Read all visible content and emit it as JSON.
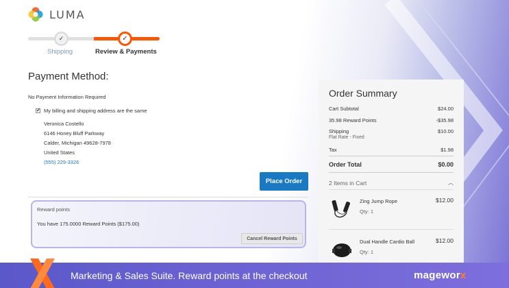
{
  "logo": {
    "text": "LUMA"
  },
  "progress": {
    "steps": [
      {
        "label": "Shipping",
        "state": "complete"
      },
      {
        "label": "Review & Payments",
        "state": "active"
      }
    ],
    "check_glyph": "✓"
  },
  "payment": {
    "title": "Payment Method:",
    "no_info": "No Payment Information Required",
    "same_address_label": "My billing and shipping address are the same",
    "same_address_checked": true,
    "address": {
      "name": "Veronica Costello",
      "street": "6146 Honey Bluff Parkway",
      "city_line": "Calder, Michigan 49628-7978",
      "country": "United States",
      "phone": "(555) 229-3326"
    },
    "place_order_label": "Place Order"
  },
  "reward": {
    "title": "Reward points",
    "text": "You have 175.0000 Reward Points ($175.00)",
    "cancel_label": "Cancel Reward Points"
  },
  "summary": {
    "title": "Order Summary",
    "rows": [
      {
        "label": "Cart Subtotal",
        "value": "$24.00"
      },
      {
        "label": "35.98 Reward Points",
        "value": "-$35.98"
      },
      {
        "label": "Shipping",
        "value": "$10.00",
        "sub": "Flat Rate - Fixed"
      },
      {
        "label": "Tax",
        "value": "$1.98"
      }
    ],
    "total": {
      "label": "Order Total",
      "value": "$0.00"
    },
    "items_in_cart": "2 Items in Cart",
    "items": [
      {
        "name": "Zing Jump Rope",
        "qty": "Qty: 1",
        "price": "$12.00",
        "icon": "jump-rope-icon"
      },
      {
        "name": "Dual Handle Cardio Ball",
        "qty": "Qty: 1",
        "price": "$12.00",
        "icon": "cardio-ball-icon"
      }
    ]
  },
  "banner": {
    "text": "Marketing & Sales Suite. Reward points at the checkout",
    "brand_a": "magewor",
    "brand_b": "x"
  },
  "colors": {
    "accent": "#ff5501",
    "primary_button": "#1979c3",
    "banner": "#6e63d4",
    "reward_border": "#b7b4ee"
  }
}
